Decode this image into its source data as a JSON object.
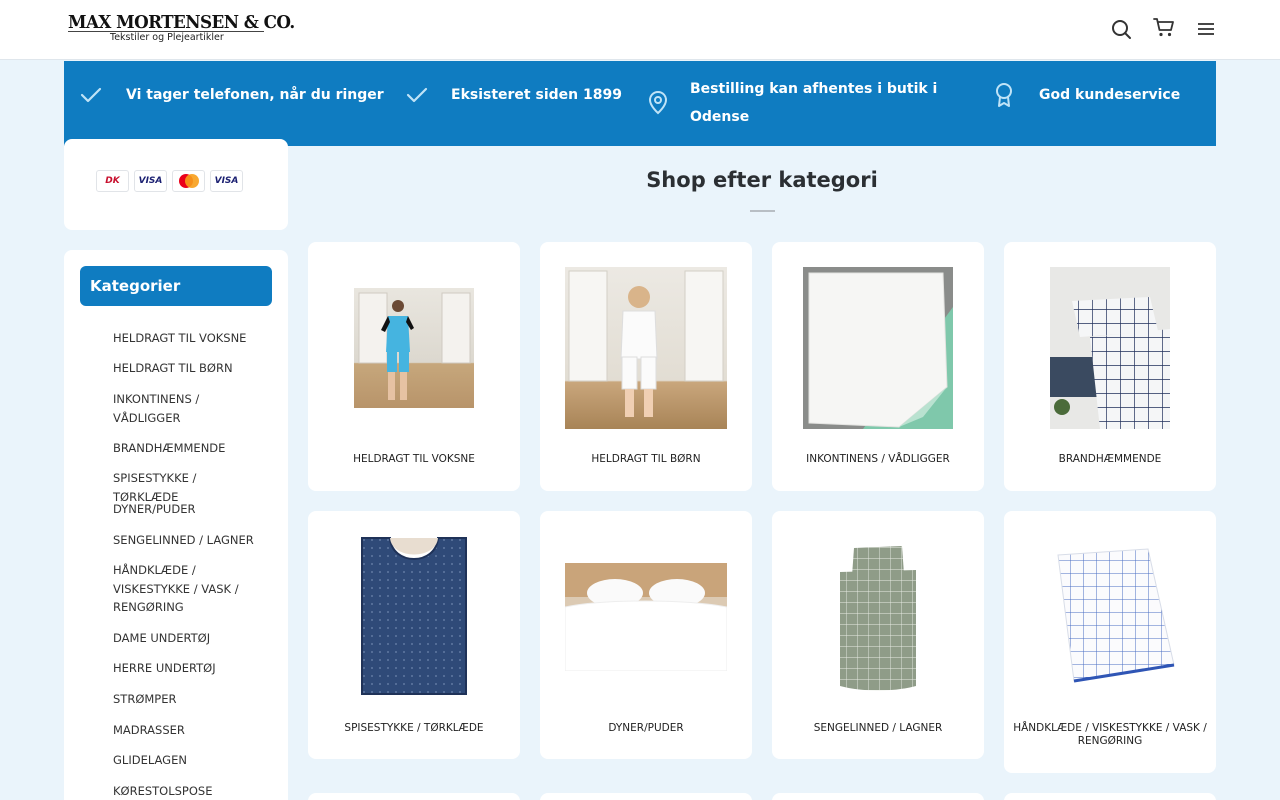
{
  "header": {
    "logo_title": "MAX MORTENSEN & CO.",
    "logo_subtitle": "Tekstiler og Plejeartikler",
    "icons": [
      "search-icon",
      "cart-icon",
      "menu-icon"
    ]
  },
  "usp": [
    {
      "icon": "check-icon",
      "text": "Vi tager telefonen, når du ringer"
    },
    {
      "icon": "check-icon",
      "text": "Eksisteret siden 1899"
    },
    {
      "icon": "map-pin-icon",
      "line1": "Bestilling kan afhentes i butik i",
      "line2": "Odense"
    },
    {
      "icon": "award-icon",
      "text": "God kundeservice"
    }
  ],
  "payment": {
    "logos": [
      "DK",
      "VISA",
      "Mastercard",
      "VISA"
    ]
  },
  "sidebar": {
    "title": "Kategorier",
    "items": [
      {
        "line1": "HELDRAGT TIL VOKSNE"
      },
      {
        "line1": "HELDRAGT TIL BØRN"
      },
      {
        "line1": "INKONTINENS /",
        "line2": "VÅDLIGGER"
      },
      {
        "line1": "BRANDHÆMMENDE"
      },
      {
        "line1": "SPISESTYKKE / TØRKLÆDE"
      },
      {
        "line1": "DYNER/PUDER"
      },
      {
        "line1": "SENGELINNED / LAGNER"
      },
      {
        "line1": "HÅNDKLÆDE /",
        "line2": "VISKESTYKKE / VASK /",
        "line3": "RENGØRING"
      },
      {
        "line1": "DAME UNDERTØJ"
      },
      {
        "line1": "HERRE UNDERTØJ"
      },
      {
        "line1": "STRØMPER"
      },
      {
        "line1": "MADRASSER"
      },
      {
        "line1": "GLIDELAGEN"
      },
      {
        "line1": "KØRESTOLSPOSE"
      }
    ]
  },
  "main": {
    "section_title": "Shop efter kategori",
    "products": [
      {
        "name": "HELDRAGT TIL VOKSNE"
      },
      {
        "name": "HELDRAGT TIL BØRN"
      },
      {
        "name": "INKONTINENS / VÅDLIGGER"
      },
      {
        "name": "BRANDHÆMMENDE"
      },
      {
        "name": "SPISESTYKKE / TØRKLÆDE"
      },
      {
        "name": "DYNER/PUDER"
      },
      {
        "name": "SENGELINNED / LAGNER"
      },
      {
        "name_line1": "HÅNDKLÆDE / VISKESTYKKE / VASK /",
        "name_line2": "RENGØRING"
      }
    ]
  },
  "colors": {
    "accent": "#0f7cc1",
    "background": "#eaf4fb"
  }
}
